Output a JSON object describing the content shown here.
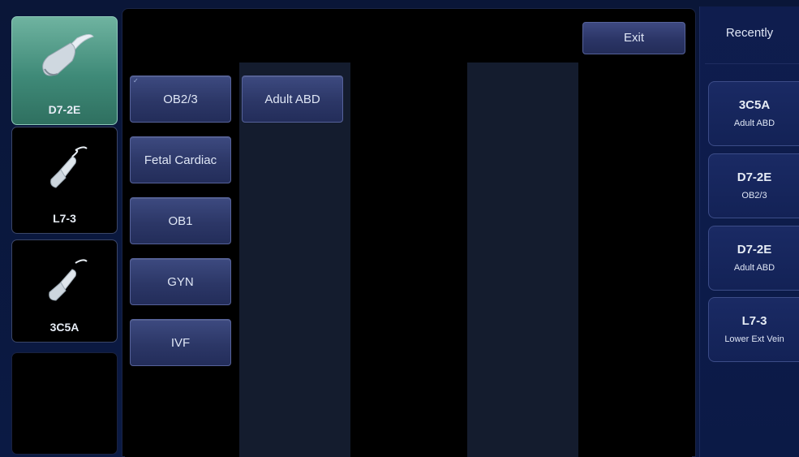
{
  "probes": [
    {
      "name": "D7-2E",
      "active": true
    },
    {
      "name": "L7-3",
      "active": false
    },
    {
      "name": "3C5A",
      "active": false
    }
  ],
  "exit_label": "Exit",
  "exam_columns": {
    "col1": [
      "OB2/3",
      "Fetal Cardiac",
      "OB1",
      "GYN",
      "IVF"
    ],
    "col2": [
      "Adult ABD"
    ]
  },
  "selected_exam_mark": "✓",
  "recently": {
    "title": "Recently",
    "items": [
      {
        "probe": "3C5A",
        "exam": "Adult ABD"
      },
      {
        "probe": "D7-2E",
        "exam": "OB2/3"
      },
      {
        "probe": "D7-2E",
        "exam": "Adult ABD"
      },
      {
        "probe": "L7-3",
        "exam": "Lower Ext Vein"
      }
    ]
  },
  "colors": {
    "accent_active": "#4f9c88",
    "button": "#2c3767",
    "background": "#0b1a44"
  }
}
